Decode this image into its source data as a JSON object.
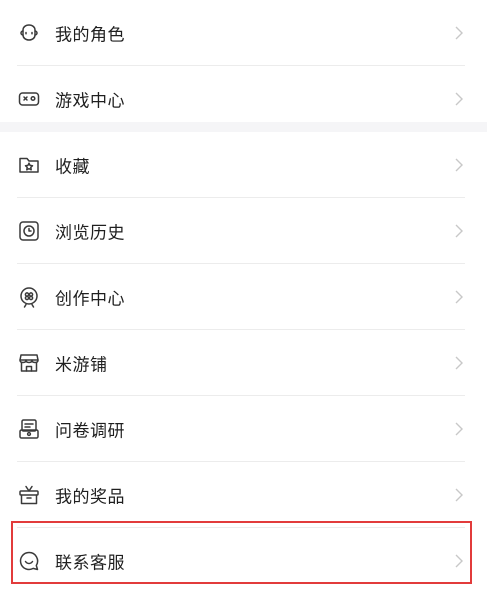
{
  "menu": {
    "group1": [
      {
        "label": "我的角色",
        "icon": "character-face-icon"
      },
      {
        "label": "游戏中心",
        "icon": "gamepad-icon"
      }
    ],
    "group2": [
      {
        "label": "收藏",
        "icon": "folder-star-icon"
      },
      {
        "label": "浏览历史",
        "icon": "clock-icon"
      },
      {
        "label": "创作中心",
        "icon": "creation-badge-icon"
      },
      {
        "label": "米游铺",
        "icon": "shop-icon"
      },
      {
        "label": "问卷调研",
        "icon": "survey-icon"
      },
      {
        "label": "我的奖品",
        "icon": "gift-icon"
      },
      {
        "label": "联系客服",
        "icon": "chat-bubble-icon"
      }
    ]
  },
  "colors": {
    "highlight_border": "#e23b3b",
    "section_gap": "#f5f5f7",
    "chevron": "#c8c8c8",
    "icon_stroke": "#3a3a3a"
  }
}
